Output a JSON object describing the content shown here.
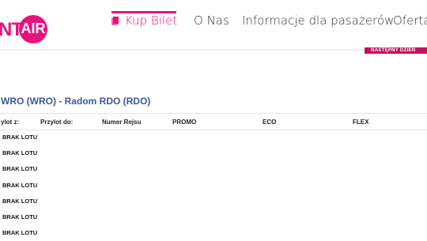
{
  "logo": {
    "left_text": "NT",
    "circle_text": "AIR"
  },
  "nav": {
    "items": [
      {
        "label": "Kup Bilet",
        "active": true
      },
      {
        "label": "O Nas",
        "active": false
      },
      {
        "label": "Informacje dla pasażerów",
        "active": false
      },
      {
        "label": "Oferta",
        "active": false
      }
    ]
  },
  "next_day_button": "NASTĘPNY DZIEŃ",
  "route_title": "WRO (WRO) - Radom RDO (RDO)",
  "table": {
    "headers": [
      "ylot z:",
      "Przylot do:",
      "Numer Rejsu",
      "PROMO",
      "ECO",
      "FLEX"
    ],
    "rows": [
      "BRAK LOTU",
      "BRAK LOTU",
      "BRAK LOTU",
      "BRAK LOTU",
      "BRAK LOTU",
      "BRAK LOTU",
      "BRAK LOTU"
    ]
  },
  "colors": {
    "brand": "#e7117f",
    "title": "#3a5a98",
    "next_day_bg": "#c4125f"
  }
}
